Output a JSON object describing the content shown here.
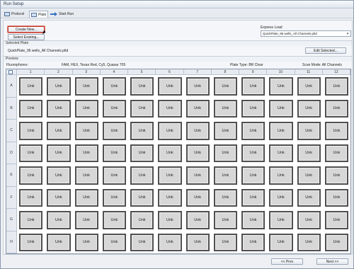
{
  "window": {
    "title": "Run Setup"
  },
  "tabs": [
    {
      "label": "Protocol"
    },
    {
      "label": "Plate"
    },
    {
      "label": "Start Run"
    }
  ],
  "buttons": {
    "create_new": "Create New...",
    "select_existing": "Select Existing...",
    "edit_selected": "Edit Selected...",
    "prev": "<< Prev",
    "next": "Next >>"
  },
  "express_load": {
    "label": "Express Load",
    "value": "QuickPlate_96 wells_All Channels.pltd"
  },
  "selected_plate": {
    "header": "Selected Plate",
    "filename": "QuickPlate_96 wells_All Channels.pltd"
  },
  "preview": {
    "header": "Preview",
    "fluorophores_label": "Fluorophores:",
    "fluorophores_value": "FAM, HEX, Texas Red, Cy5, Quasar 705",
    "plate_type": "Plate Type: BR Clear",
    "scan_mode": "Scan Mode: All Channels"
  },
  "plate": {
    "columns": [
      "1",
      "2",
      "3",
      "4",
      "5",
      "6",
      "7",
      "8",
      "9",
      "10",
      "11",
      "12"
    ],
    "rows": [
      "A",
      "B",
      "C",
      "D",
      "E",
      "F",
      "G",
      "H"
    ],
    "well_label": "Unk"
  },
  "colors": {
    "highlight": "#c0392b",
    "well_fill": "#d7d7d7",
    "well_border": "#505050"
  }
}
